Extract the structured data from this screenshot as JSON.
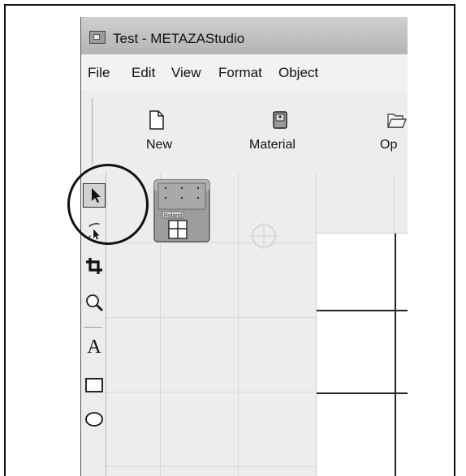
{
  "window": {
    "title": "Test - METAZAStudio"
  },
  "menu": {
    "items": [
      "File",
      "Edit",
      "View",
      "Format",
      "Object"
    ]
  },
  "toolbar": {
    "buttons": [
      {
        "label": "New",
        "icon": "new-document-icon"
      },
      {
        "label": "Material",
        "icon": "material-icon"
      },
      {
        "label": "Op",
        "icon": "open-folder-icon"
      }
    ]
  },
  "tools": [
    {
      "name": "select-arrow-tool",
      "icon": "arrow-pointer-icon",
      "selected": true
    },
    {
      "name": "object-edit-tool",
      "icon": "edit-pointer-icon",
      "selected": false
    },
    {
      "name": "crop-tool",
      "icon": "crop-icon",
      "selected": false
    },
    {
      "name": "zoom-tool",
      "icon": "magnifier-icon",
      "selected": false
    },
    {
      "name": "text-tool",
      "icon": "letter-a-icon",
      "selected": false
    },
    {
      "name": "rectangle-tool",
      "icon": "rectangle-icon",
      "selected": false
    },
    {
      "name": "ellipse-tool",
      "icon": "ellipse-icon",
      "selected": false
    }
  ],
  "canvas": {
    "material_thumbnail_label": "Roland",
    "text_tool_glyph": "A"
  },
  "colors": {
    "highlight_ring": "#111111",
    "canvas_background": "#ededed",
    "grid_lines": "#d9d9d9"
  }
}
